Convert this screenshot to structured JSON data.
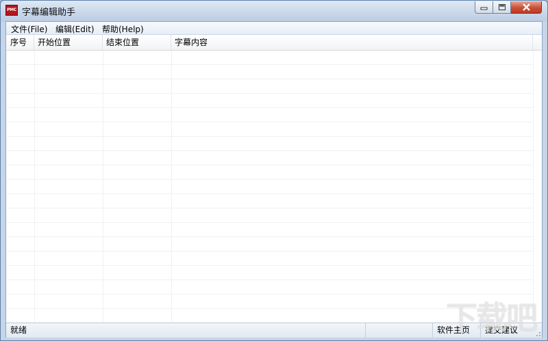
{
  "window": {
    "icon_label": "PMC",
    "title": "字幕编辑助手"
  },
  "menu": [
    {
      "label": "文件(File)"
    },
    {
      "label": "编辑(Edit)"
    },
    {
      "label": "帮助(Help)"
    }
  ],
  "table": {
    "columns": [
      "序号",
      "开始位置",
      "结束位置",
      "字幕内容"
    ],
    "rows": []
  },
  "status": {
    "text": "就绪",
    "homepage_link": "软件主页",
    "feedback_link": "提交建议"
  },
  "watermark": "下载吧",
  "colors": {
    "title_bar": "#c6d5e8",
    "close_button": "#c94f38",
    "app_icon": "#b3161b"
  }
}
